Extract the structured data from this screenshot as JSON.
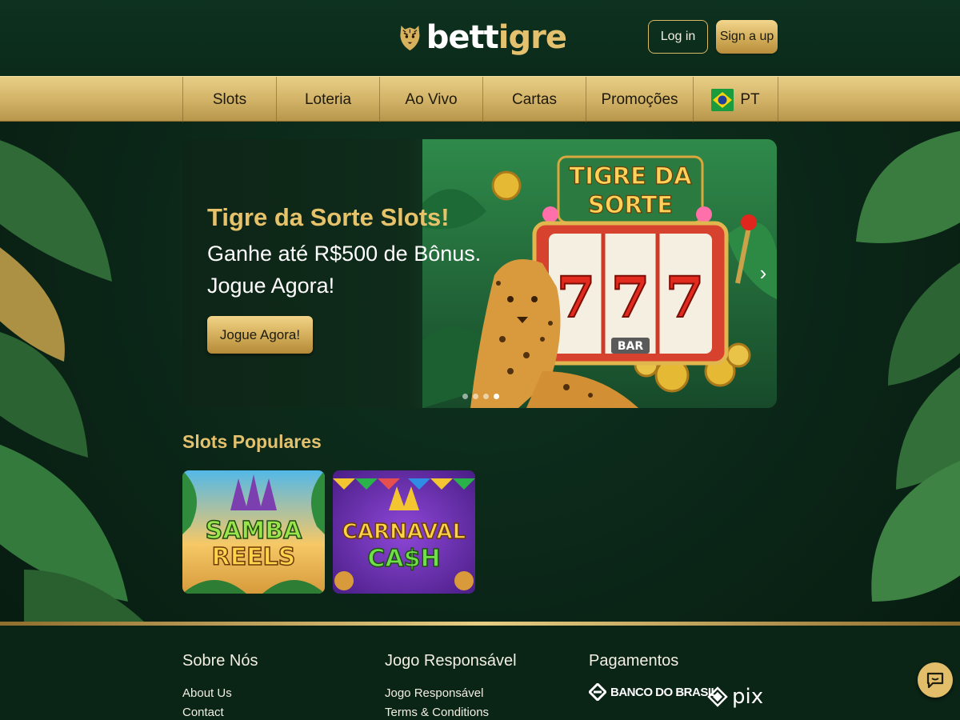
{
  "brand": {
    "name_left": "bett",
    "name_right": "igre"
  },
  "header": {
    "login_label": "Log in",
    "signup_label": "Sign a up"
  },
  "nav": {
    "items": [
      {
        "label": "Slots"
      },
      {
        "label": "Loteria"
      },
      {
        "label": "Ao Vivo"
      },
      {
        "label": "Cartas"
      },
      {
        "label": "Promoções"
      }
    ],
    "language": {
      "label": "PT",
      "flag_icon": "brazil-flag-icon"
    }
  },
  "hero": {
    "title": "Tigre da Sorte Slots!",
    "line1": "Ganhe até R$500 de Bônus.",
    "line2": "Jogue Agora!",
    "cta_label": "Jogue Agora!",
    "art_title_line1": "TIGRE DA",
    "art_title_line2": "SORTE",
    "reel_symbol": "7",
    "bar_label": "BAR",
    "slide_count": 4,
    "active_slide": 4
  },
  "popular": {
    "title": "Slots Populares",
    "games": [
      {
        "title_line1": "SAMBA",
        "title_line2": "REELS"
      },
      {
        "title_line1": "CARNAVAL",
        "title_line2": "CA$H"
      }
    ]
  },
  "footer": {
    "about": {
      "title": "Sobre Nós",
      "links": [
        "About Us",
        "Contact"
      ]
    },
    "responsible": {
      "title": "Jogo Responsável",
      "links": [
        "Jogo Responsável",
        "Terms & Conditions"
      ]
    },
    "payments": {
      "title": "Pagamentos",
      "bank_label": "BANCO DO BRASIL",
      "pix_label": "pix"
    }
  },
  "colors": {
    "gold": "#e3c16f",
    "dark_green": "#0c2a1a",
    "nav_gold": "#d3b468"
  }
}
